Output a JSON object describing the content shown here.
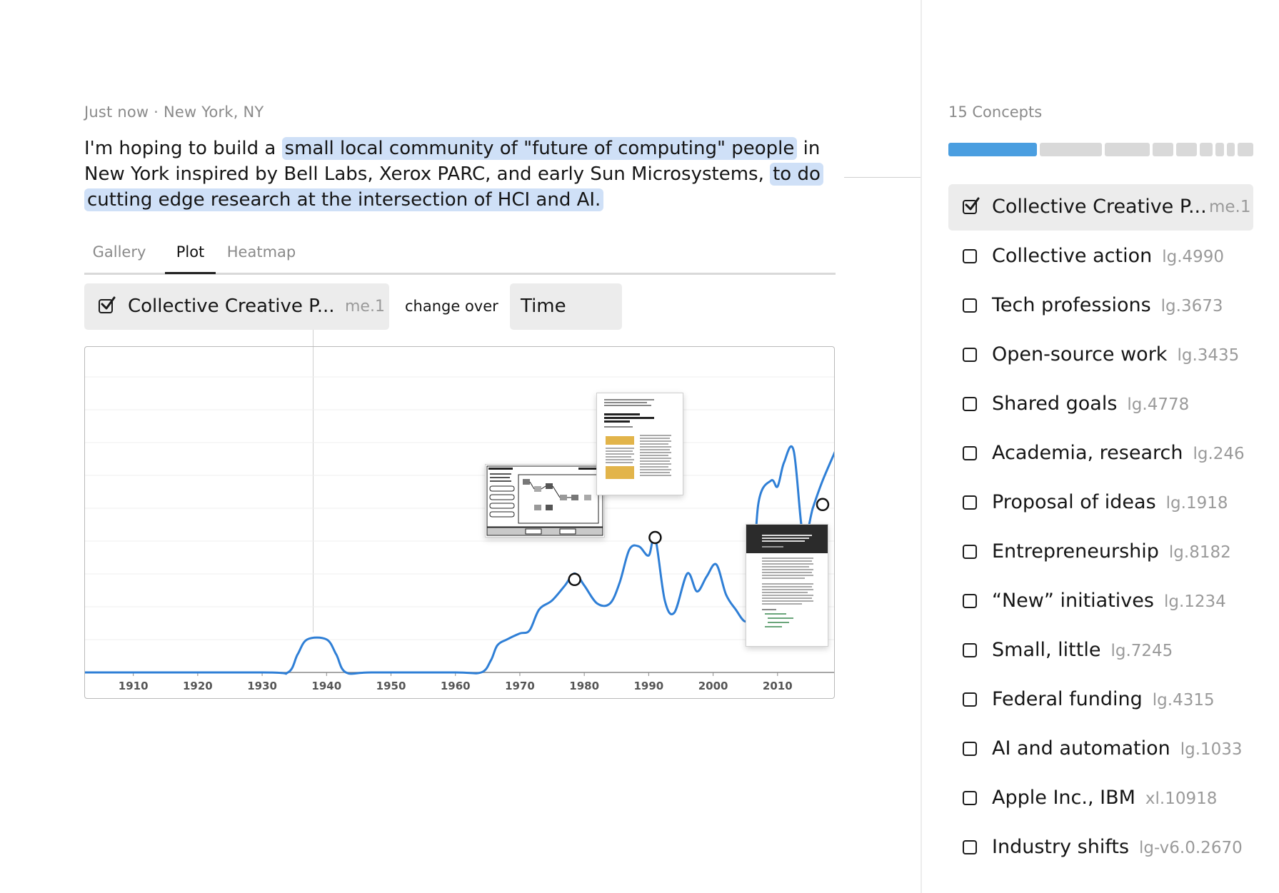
{
  "meta": {
    "timestamp": "Just now",
    "separator": " · ",
    "location": "New York, NY"
  },
  "prompt": {
    "segments": [
      {
        "text": "I'm hoping to build a ",
        "highlight": false
      },
      {
        "text": "small local community of \"future of computing\" people",
        "highlight": true
      },
      {
        "text": " in New York inspired by Bell Labs, Xerox PARC, and early Sun Microsystems, ",
        "highlight": false
      },
      {
        "text": "to do cutting edge research at the intersection of HCI and AI.",
        "highlight": true
      }
    ]
  },
  "tabs": [
    {
      "label": "Gallery",
      "active": false
    },
    {
      "label": "Plot",
      "active": true
    },
    {
      "label": "Heatmap",
      "active": false
    }
  ],
  "controls": {
    "concept_label": "Collective Creative P...",
    "concept_code": "me.1",
    "change_over": "change over",
    "time_label": "Time"
  },
  "chart_data": {
    "type": "line",
    "x_ticks": [
      1910,
      1920,
      1930,
      1940,
      1950,
      1960,
      1970,
      1980,
      1990,
      2000,
      2010
    ],
    "xlim": [
      1902.5,
      2019
    ],
    "ylim": [
      0,
      1
    ],
    "grid": true,
    "series": [
      {
        "color": "#2f7fd6",
        "x": [
          1902.5,
          1930,
          1934,
          1935.5,
          1937,
          1940,
          1941.5,
          1943,
          1947,
          1960,
          1964,
          1965.5,
          1966.5,
          1968,
          1970,
          1971.5,
          1973,
          1975,
          1977,
          1978.5,
          1980,
          1982,
          1984,
          1985.5,
          1987,
          1988.5,
          1990,
          1991,
          1992.5,
          1994,
          1996,
          1997.5,
          1999,
          2000.5,
          2002,
          2003.5,
          2005,
          2006,
          2007,
          2009,
          2010,
          2011,
          2012.5,
          2014,
          2015.5,
          2017,
          2019
        ],
        "y": [
          0,
          0,
          0,
          0.06,
          0.11,
          0.11,
          0.06,
          0,
          0,
          0,
          0,
          0.04,
          0.09,
          0.11,
          0.13,
          0.14,
          0.21,
          0.24,
          0.29,
          0.33,
          0.29,
          0.23,
          0.23,
          0.3,
          0.41,
          0.42,
          0.39,
          0.45,
          0.24,
          0.2,
          0.33,
          0.27,
          0.32,
          0.36,
          0.26,
          0.21,
          0.17,
          0.21,
          0.56,
          0.64,
          0.62,
          0.7,
          0.74,
          0.45,
          0.55,
          0.64,
          0.74
        ]
      }
    ],
    "highlight_points": [
      {
        "x": 1978.5,
        "y": 0.31
      },
      {
        "x": 1991,
        "y": 0.45
      },
      {
        "x": 2017,
        "y": 0.56
      }
    ]
  },
  "sidebar": {
    "concepts_count": "15 Concepts",
    "concepts": [
      {
        "name": "Collective Creative P...",
        "code": "me.1",
        "checked": true
      },
      {
        "name": "Collective action",
        "code": "lg.4990",
        "checked": false
      },
      {
        "name": "Tech professions",
        "code": "lg.3673",
        "checked": false
      },
      {
        "name": "Open-source work",
        "code": "lg.3435",
        "checked": false
      },
      {
        "name": "Shared goals",
        "code": "lg.4778",
        "checked": false
      },
      {
        "name": "Academia, research",
        "code": "lg.246",
        "checked": false
      },
      {
        "name": "Proposal of ideas",
        "code": "lg.1918",
        "checked": false
      },
      {
        "name": "Entrepreneurship",
        "code": "lg.8182",
        "checked": false
      },
      {
        "name": "“New” initiatives",
        "code": "lg.1234",
        "checked": false
      },
      {
        "name": "Small, little",
        "code": "lg.7245",
        "checked": false
      },
      {
        "name": "Federal funding",
        "code": "lg.4315",
        "checked": false
      },
      {
        "name": "AI and automation",
        "code": "lg.1033",
        "checked": false
      },
      {
        "name": "Apple Inc., IBM",
        "code": "xl.10918",
        "checked": false
      },
      {
        "name": "Industry shifts",
        "code": "lg-v6.0.2670",
        "checked": false
      }
    ]
  },
  "colors": {
    "accent": "#2f7fd6",
    "highlight": "#cfe0f7",
    "chip": "#ececec"
  }
}
